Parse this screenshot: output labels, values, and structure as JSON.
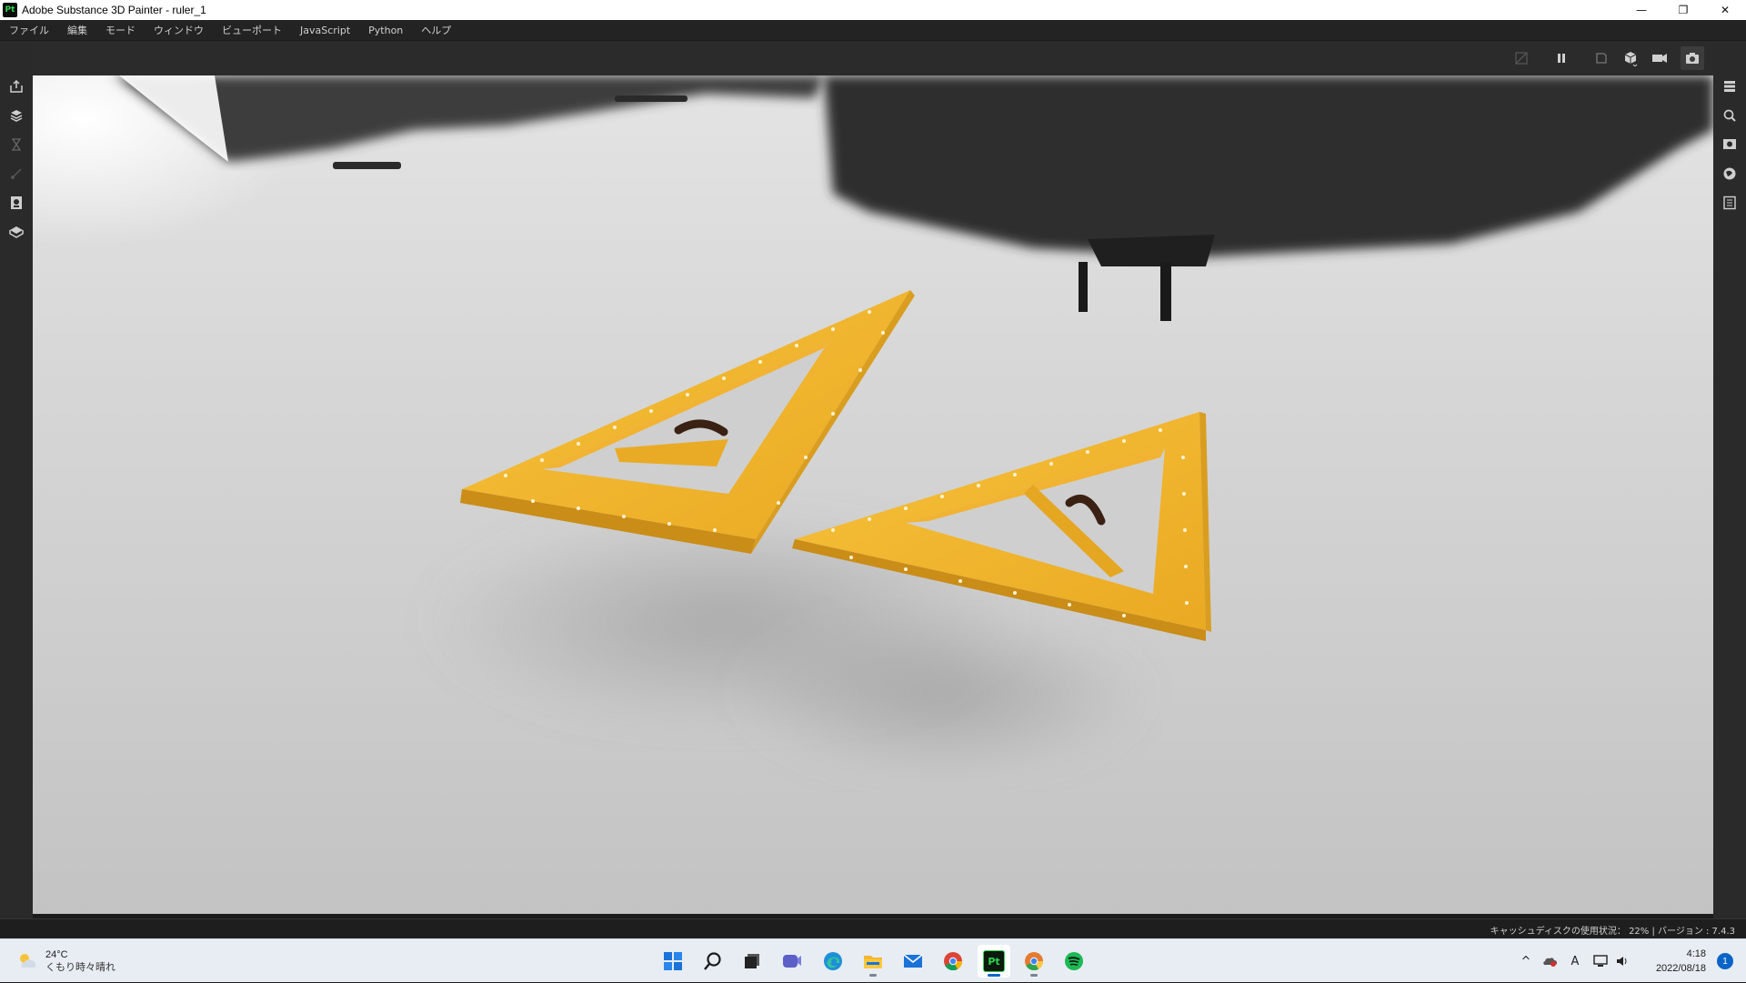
{
  "window": {
    "app_icon_text": "Pt",
    "title": "Adobe Substance 3D Painter - ruler_1",
    "controls": {
      "minimize": "—",
      "restore": "❐",
      "close": "✕"
    }
  },
  "menu": {
    "items": [
      "ファイル",
      "編集",
      "モード",
      "ウィンドウ",
      "ビューポート",
      "JavaScript",
      "Python",
      "ヘルプ"
    ]
  },
  "toolbar": {
    "icons": [
      "bake-icon",
      "pause-icon",
      "frame-icon",
      "cube-view-icon",
      "camera-icon",
      "screenshot-icon"
    ]
  },
  "left_rail": {
    "icons": [
      "export-icon",
      "texture-set-icon",
      "history-icon",
      "brush-icon",
      "document-icon",
      "layers-3d-icon"
    ]
  },
  "right_rail": {
    "icons": [
      "layers-panel-icon",
      "search-panel-icon",
      "display-settings-icon",
      "environment-icon",
      "properties-icon"
    ]
  },
  "statusbar": {
    "text": "キャッシュディスクの使用状況： 22% | バージョン : 7.4.3"
  },
  "taskbar": {
    "weather": {
      "temp": "24°C",
      "desc": "くもり時々晴れ"
    },
    "apps": [
      "start-icon",
      "search-icon",
      "task-view-icon",
      "teams-icon",
      "edge-icon",
      "file-explorer-icon",
      "mail-icon",
      "chrome-icon",
      "substance-painter-icon",
      "chrome-canary-icon",
      "spotify-icon"
    ],
    "active_app": "substance-painter-icon",
    "painter_label": "Pt",
    "tray": {
      "chevron": "^",
      "ime": "A"
    },
    "clock": {
      "time": "4:18",
      "date": "2022/08/18"
    },
    "notifications": "1"
  },
  "colors": {
    "ruler_yellow": "#f2b32a",
    "ruler_edge": "#c98d18",
    "handle": "#3a2114",
    "accent": "#0a64c8"
  }
}
